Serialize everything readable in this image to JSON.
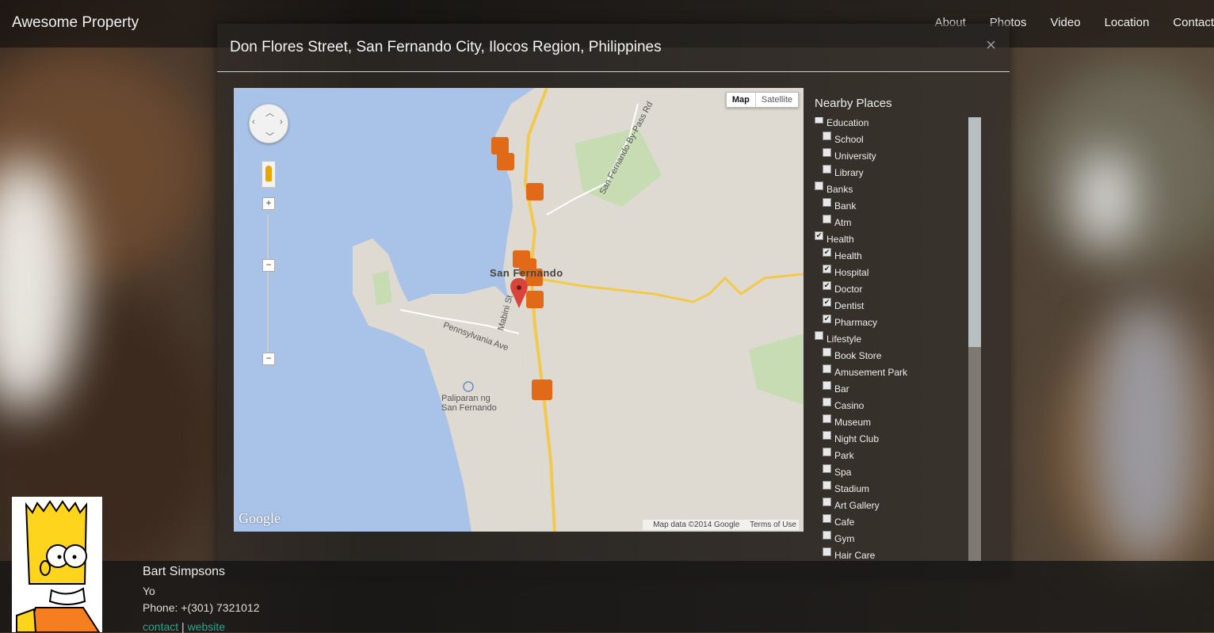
{
  "navbar": {
    "brand": "Awesome Property",
    "links": [
      "About",
      "Photos",
      "Video",
      "Location",
      "Contact"
    ]
  },
  "modal": {
    "title": "Don Flores Street, San Fernando City, Ilocos Region, Philippines",
    "close": "×"
  },
  "map": {
    "type_map": "Map",
    "type_satellite": "Satellite",
    "city_label": "San Fernando",
    "road_labels": [
      "San Fernando By-Pass Rd",
      "Mabini St",
      "Pennsylvania Ave"
    ],
    "airport_label": [
      "Paliparan ng",
      "San Fernando"
    ],
    "logo": "Google",
    "credit": "Map data ©2014 Google",
    "terms": "Terms of Use",
    "zoom_in": "+",
    "zoom_out": "−"
  },
  "nearby": {
    "title": "Nearby Places",
    "items": [
      {
        "label": "Education",
        "checked": false,
        "sub": false
      },
      {
        "label": "School",
        "checked": false,
        "sub": true
      },
      {
        "label": "University",
        "checked": false,
        "sub": true
      },
      {
        "label": "Library",
        "checked": false,
        "sub": true
      },
      {
        "label": "Banks",
        "checked": false,
        "sub": false
      },
      {
        "label": "Bank",
        "checked": false,
        "sub": true
      },
      {
        "label": "Atm",
        "checked": false,
        "sub": true
      },
      {
        "label": "Health",
        "checked": true,
        "sub": false
      },
      {
        "label": "Health",
        "checked": true,
        "sub": true
      },
      {
        "label": "Hospital",
        "checked": true,
        "sub": true
      },
      {
        "label": "Doctor",
        "checked": true,
        "sub": true
      },
      {
        "label": "Dentist",
        "checked": true,
        "sub": true
      },
      {
        "label": "Pharmacy",
        "checked": true,
        "sub": true
      },
      {
        "label": "Lifestyle",
        "checked": false,
        "sub": false
      },
      {
        "label": "Book Store",
        "checked": false,
        "sub": true
      },
      {
        "label": "Amusement Park",
        "checked": false,
        "sub": true
      },
      {
        "label": "Bar",
        "checked": false,
        "sub": true
      },
      {
        "label": "Casino",
        "checked": false,
        "sub": true
      },
      {
        "label": "Museum",
        "checked": false,
        "sub": true
      },
      {
        "label": "Night Club",
        "checked": false,
        "sub": true
      },
      {
        "label": "Park",
        "checked": false,
        "sub": true
      },
      {
        "label": "Spa",
        "checked": false,
        "sub": true
      },
      {
        "label": "Stadium",
        "checked": false,
        "sub": true
      },
      {
        "label": "Art Gallery",
        "checked": false,
        "sub": true
      },
      {
        "label": "Cafe",
        "checked": false,
        "sub": true
      },
      {
        "label": "Gym",
        "checked": false,
        "sub": true
      },
      {
        "label": "Hair Care",
        "checked": false,
        "sub": true
      }
    ]
  },
  "agent": {
    "name": "Bart Simpsons",
    "title": "Yo",
    "phone": "Phone: +(301) 7321012",
    "contact_link": "contact",
    "separator": "|",
    "website_link": "website"
  },
  "colors": {
    "marker_orange": "#e06a18",
    "pin_red": "#d9443a",
    "water": "#a9c2e8",
    "road_yellow": "#f2c94c"
  }
}
